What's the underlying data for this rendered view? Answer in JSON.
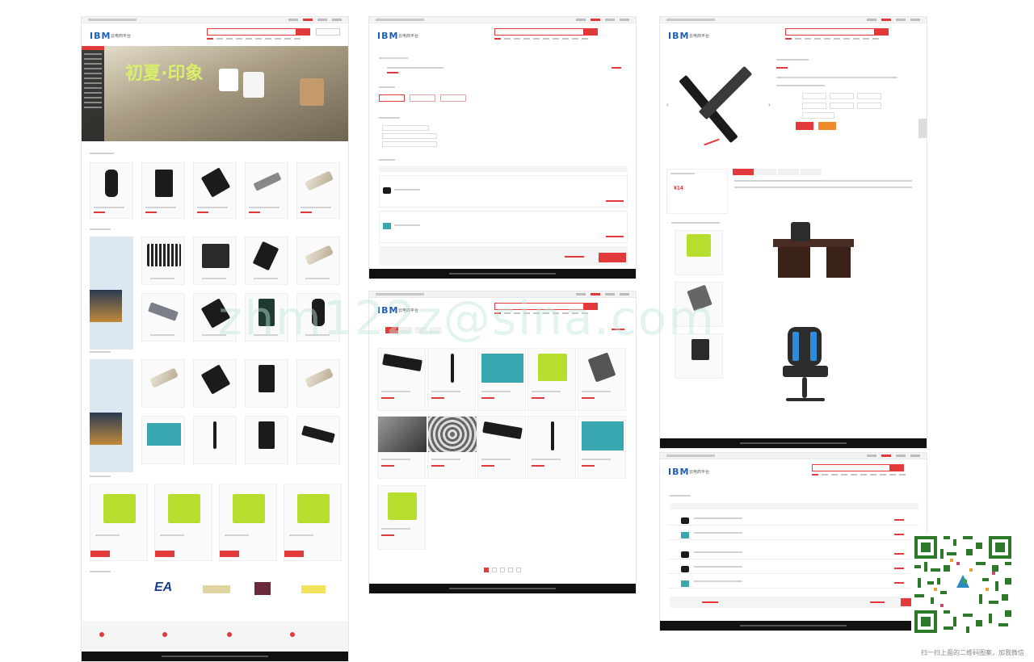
{
  "panels": {
    "home": {
      "logo": "IBM",
      "logo_sub": "云电商平台",
      "banner_title": "初夏·印象"
    },
    "cart": {
      "logo": "IBM",
      "logo_sub": "云电商平台"
    },
    "list": {
      "logo": "IBM",
      "logo_sub": "云电商平台"
    },
    "detail": {
      "logo": "IBM",
      "logo_sub": "云电商平台",
      "price": "¥14"
    },
    "order": {
      "logo": "IBM",
      "logo_sub": "云电商平台"
    }
  },
  "watermark": "zhm122z@sina.com",
  "qr_caption": "扫一扫上面的二维码图案，加我微信",
  "brand_logos": [
    "EA"
  ],
  "colors": {
    "accent": "#e23a3a",
    "footer": "#111111",
    "logo": "#1f5fb5"
  }
}
